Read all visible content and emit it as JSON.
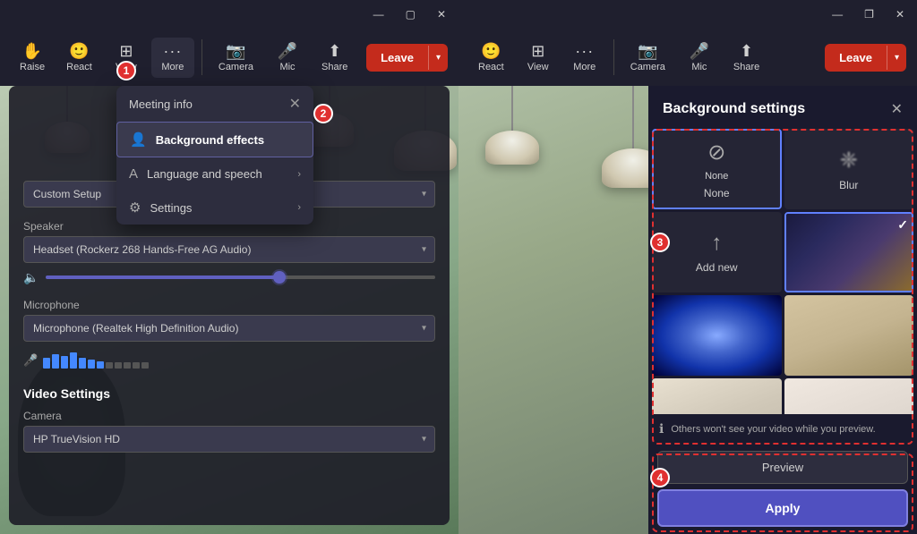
{
  "left": {
    "titleBar": {
      "minimize": "—",
      "maximize": "▢",
      "close": "✕"
    },
    "toolbar": {
      "items": [
        {
          "id": "raise",
          "icon": "✋",
          "label": "Raise"
        },
        {
          "id": "react",
          "icon": "🙂",
          "label": "React"
        },
        {
          "id": "view",
          "icon": "⊞",
          "label": "View"
        },
        {
          "id": "more",
          "icon": "•••",
          "label": "More"
        }
      ],
      "camera": {
        "icon": "📷",
        "label": "Camera"
      },
      "mic": {
        "icon": "🎤",
        "label": "Mic"
      },
      "share": {
        "icon": "⬆",
        "label": "Share"
      },
      "leave": "Leave",
      "chevron": "▾"
    },
    "stepBadge1": "1",
    "moreMenuBadge": "1",
    "dropdown": {
      "header": "Meeting info",
      "closeIcon": "✕",
      "items": [
        {
          "id": "background",
          "icon": "👤",
          "label": "Background effects",
          "arrow": "",
          "highlighted": true
        },
        {
          "id": "language",
          "icon": "A",
          "label": "Language and speech",
          "arrow": "›"
        },
        {
          "id": "settings",
          "icon": "⚙",
          "label": "Settings",
          "arrow": "›"
        }
      ]
    },
    "stepBadge2": "2",
    "settings": {
      "audioSetup": "Custom Setup",
      "speakerLabel": "Speaker",
      "speakerValue": "Headset (Rockerz 268 Hands-Free AG Audio)",
      "micLabel": "Microphone",
      "micValue": "Microphone (Realtek High Definition Audio)",
      "videoTitle": "Video Settings",
      "cameraLabel": "Camera",
      "cameraValue": "HP TrueVision HD"
    }
  },
  "right": {
    "titleBar": {
      "minimize": "—",
      "maximize": "❐",
      "close": "✕"
    },
    "toolbar": {
      "items": [
        {
          "id": "react",
          "icon": "🙂",
          "label": "React"
        },
        {
          "id": "view",
          "icon": "⊞",
          "label": "View"
        },
        {
          "id": "more",
          "icon": "•••",
          "label": "More"
        }
      ],
      "camera": {
        "icon": "📷",
        "label": "Camera"
      },
      "mic": {
        "icon": "🎤",
        "label": "Mic"
      },
      "share": {
        "icon": "⬆",
        "label": "Share"
      },
      "leave": "Leave",
      "chevron": "▾"
    },
    "bgSettings": {
      "title": "Background settings",
      "closeIcon": "✕",
      "cells": [
        {
          "id": "none",
          "icon": "⊘",
          "label": "None",
          "type": "icon",
          "selected": false
        },
        {
          "id": "blur",
          "icon": "❈",
          "label": "Blur",
          "type": "icon",
          "selected": false
        },
        {
          "id": "add-new",
          "icon": "↑",
          "label": "Add new",
          "type": "icon",
          "selected": false
        },
        {
          "id": "space",
          "label": "",
          "type": "image",
          "style": "space",
          "selected": true,
          "check": "✓"
        },
        {
          "id": "tunnel",
          "label": "",
          "type": "image",
          "style": "tunnel",
          "selected": false
        },
        {
          "id": "room",
          "label": "",
          "type": "image",
          "style": "room",
          "selected": false
        },
        {
          "id": "office",
          "label": "",
          "type": "image",
          "style": "office",
          "selected": false
        },
        {
          "id": "kitchen",
          "label": "",
          "type": "image",
          "style": "kitchen",
          "selected": false
        }
      ],
      "infoText": "Others won't see your video while you preview.",
      "previewLabel": "Preview",
      "applyLabel": "Apply",
      "stepBadge3": "3",
      "stepBadge4": "4"
    }
  }
}
